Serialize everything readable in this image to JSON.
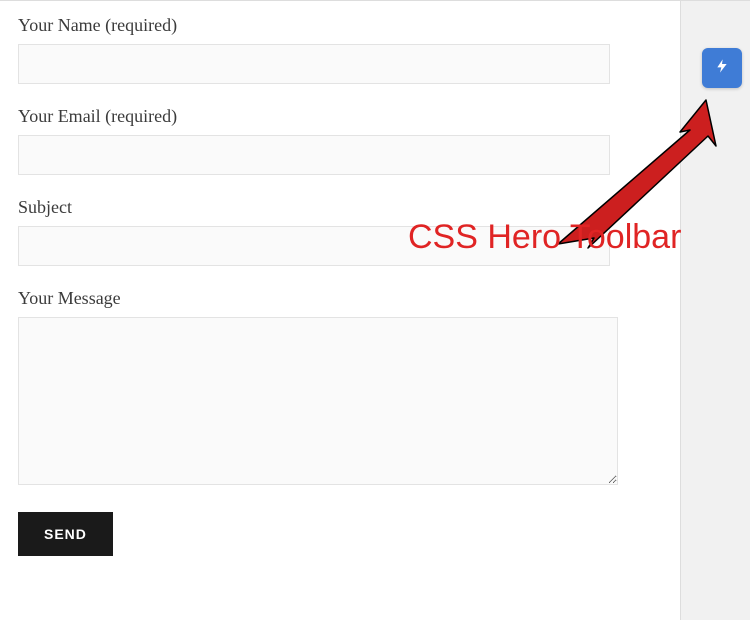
{
  "form": {
    "name": {
      "label": "Your Name (required)",
      "value": ""
    },
    "email": {
      "label": "Your Email (required)",
      "value": ""
    },
    "subject": {
      "label": "Subject",
      "value": ""
    },
    "message": {
      "label": "Your Message",
      "value": ""
    },
    "submit_label": "SEND"
  },
  "toolbar": {
    "icon": "lightning-icon",
    "color": "#3f7cd6"
  },
  "annotation": {
    "text": "CSS Hero Toolbar",
    "color": "#e02424"
  }
}
